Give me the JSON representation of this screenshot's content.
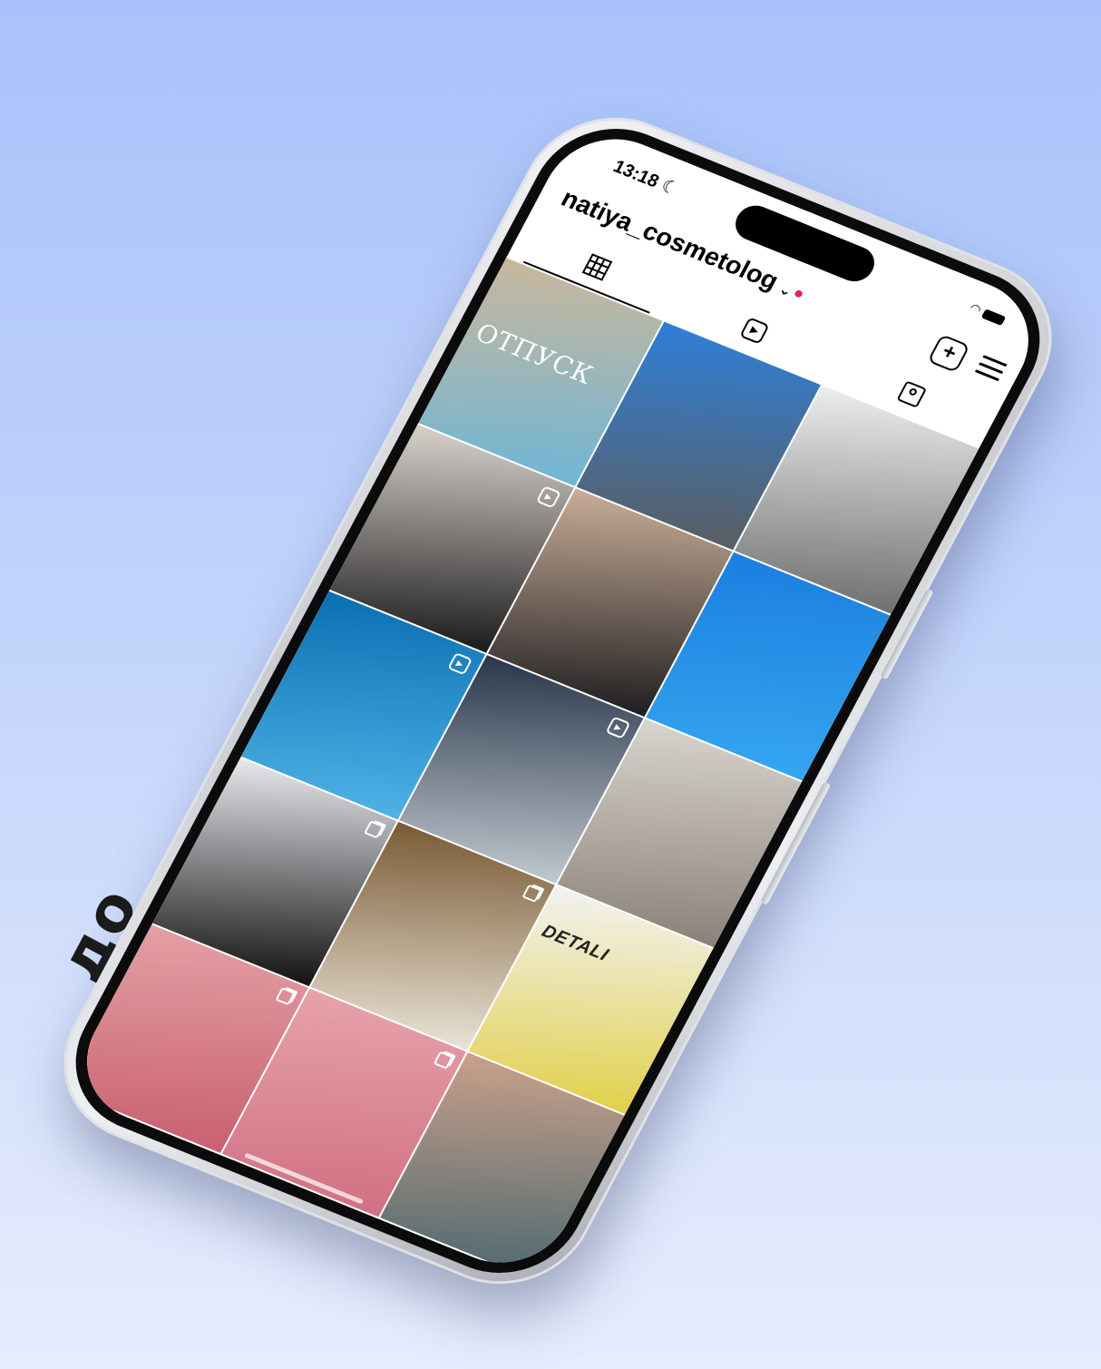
{
  "side_caption": "до",
  "status_bar": {
    "time": "13:18",
    "moon_icon": "moon-icon",
    "wifi_icon": "wifi-icon",
    "battery_icon": "battery-icon"
  },
  "header": {
    "username": "natiya_cosmetolog",
    "dropdown_icon": "chevron-down-icon",
    "add_icon": "plus-square-icon",
    "menu_icon": "hamburger-icon"
  },
  "tabs": [
    {
      "name": "grid",
      "icon": "grid-icon",
      "active": true
    },
    {
      "name": "reels",
      "icon": "reels-icon",
      "active": false
    },
    {
      "name": "tagged",
      "icon": "tagged-person-icon",
      "active": false
    }
  ],
  "grid": {
    "posts": [
      {
        "caption": "ОТПУСК",
        "badge": "",
        "colors": [
          "#c9b79c",
          "#6fb6d6"
        ]
      },
      {
        "caption": "",
        "badge": "",
        "colors": [
          "#2f7fd8",
          "#5a5e62"
        ]
      },
      {
        "caption": "",
        "badge": "",
        "colors": [
          "#eceded",
          "#6e7070"
        ]
      },
      {
        "caption": "",
        "badge": "reel",
        "colors": [
          "#d8d2cc",
          "#1b1b1b"
        ]
      },
      {
        "caption": "",
        "badge": "",
        "colors": [
          "#c9ad98",
          "#1e1e20"
        ]
      },
      {
        "caption": "",
        "badge": "",
        "colors": [
          "#1a7fe0",
          "#35a6f0"
        ]
      },
      {
        "caption": "",
        "badge": "reel",
        "colors": [
          "#0a6fb2",
          "#4fb3e6"
        ]
      },
      {
        "caption": "",
        "badge": "reel",
        "colors": [
          "#29364a",
          "#c0c8cf"
        ]
      },
      {
        "caption": "",
        "badge": "",
        "colors": [
          "#d8d4ce",
          "#8a8278"
        ]
      },
      {
        "caption": "",
        "badge": "multi",
        "colors": [
          "#e8e9ee",
          "#121212"
        ]
      },
      {
        "caption": "",
        "badge": "multi",
        "colors": [
          "#7a5a34",
          "#e9e3d6"
        ]
      },
      {
        "caption": "DETALI",
        "badge": "",
        "colors": [
          "#f2f2f2",
          "#e1d04a"
        ]
      },
      {
        "caption": "",
        "badge": "multi",
        "colors": [
          "#e3a0a4",
          "#c96070"
        ]
      },
      {
        "caption": "",
        "badge": "multi",
        "colors": [
          "#e7a2ac",
          "#d07082"
        ]
      },
      {
        "caption": "",
        "badge": "",
        "colors": [
          "#c9a08a",
          "#4e6870"
        ]
      }
    ]
  }
}
